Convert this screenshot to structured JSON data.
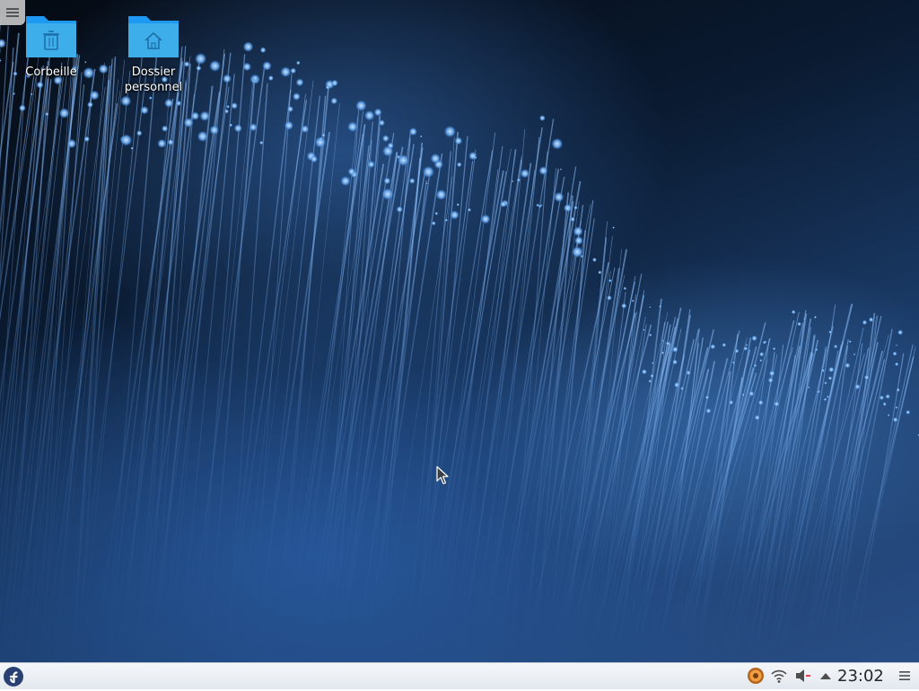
{
  "desktop": {
    "icons": [
      {
        "label": "Corbeille",
        "icon": "trash-folder-icon"
      },
      {
        "label": "Dossier\npersonnel",
        "icon": "home-folder-icon"
      }
    ],
    "toolbox_icon": "hamburger-menu-icon"
  },
  "panel": {
    "launcher_icon": "fedora-logo-icon",
    "tray_icons": [
      "update-notifier-icon",
      "wifi-icon",
      "volume-muted-icon",
      "expand-arrow-up-icon"
    ],
    "clock": "23:02",
    "menu_icon": "panel-menu-icon"
  },
  "colors": {
    "panel_bg": "#e8edf2",
    "folder_blue": "#3daee9",
    "fedora_blue": "#294172",
    "mute_red": "#da4453"
  }
}
